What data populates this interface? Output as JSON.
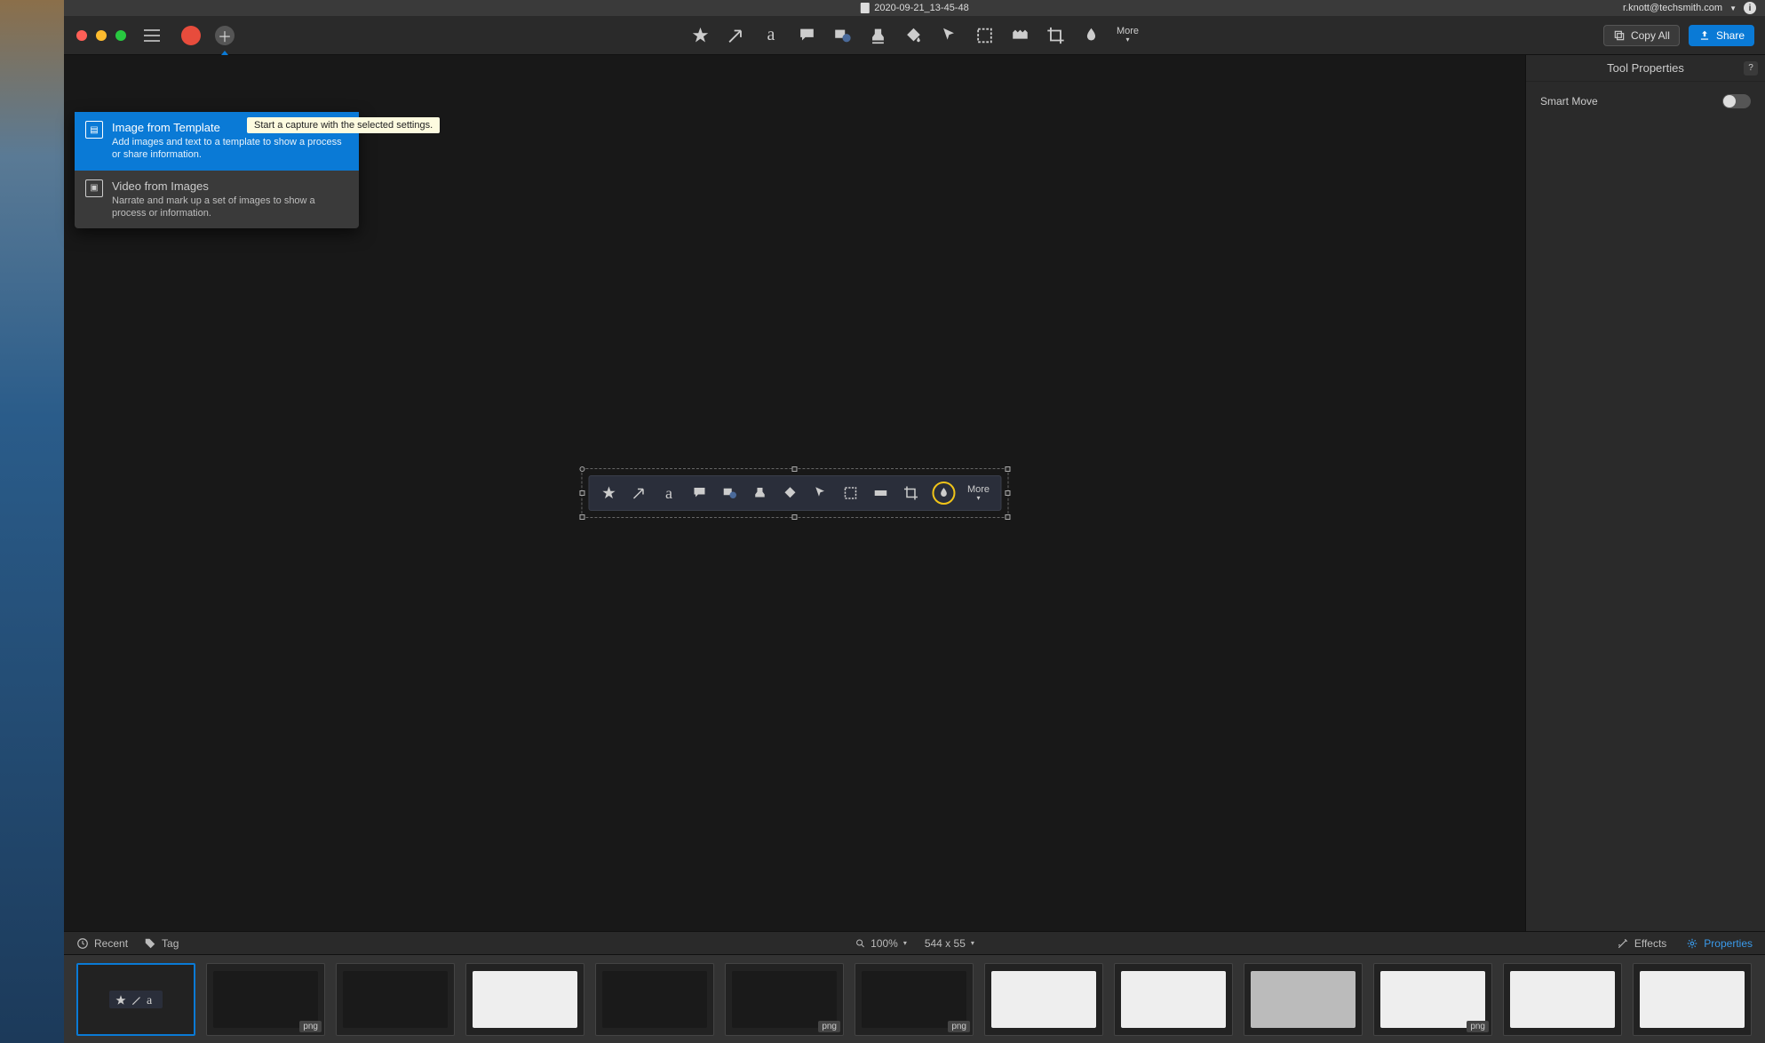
{
  "titlebar": {
    "filename": "2020-09-21_13-45-48",
    "user_email": "r.knott@techsmith.com"
  },
  "toolbar": {
    "more_label": "More",
    "copy_all_label": "Copy All",
    "share_label": "Share",
    "tools": [
      "favorites",
      "arrow",
      "text",
      "callout",
      "shape",
      "stamp",
      "fill",
      "move",
      "selection",
      "blur",
      "crop",
      "simplify"
    ]
  },
  "popover": {
    "items": [
      {
        "title": "Image from Template",
        "desc": "Add images and text to a template to show a process or share information.",
        "selected": true
      },
      {
        "title": "Video from Images",
        "desc": "Narrate and mark up a set of images to show a process or information.",
        "selected": false
      }
    ],
    "tooltip": "Start a capture with the selected settings."
  },
  "properties": {
    "title": "Tool Properties",
    "rows": [
      {
        "label": "Smart Move",
        "value": false
      }
    ]
  },
  "canvas_object": {
    "more_label": "More"
  },
  "tray_bar": {
    "recent": "Recent",
    "tag": "Tag",
    "zoom": "100%",
    "dimensions": "544 x 55",
    "effects": "Effects",
    "properties": "Properties"
  },
  "tray": {
    "thumbs": [
      {
        "type": "selected-bar"
      },
      {
        "type": "dark",
        "badge": "png"
      },
      {
        "type": "dark"
      },
      {
        "type": "light"
      },
      {
        "type": "dark"
      },
      {
        "type": "dark",
        "badge": "png"
      },
      {
        "type": "dark",
        "badge": "png"
      },
      {
        "type": "light"
      },
      {
        "type": "light"
      },
      {
        "type": "gray"
      },
      {
        "type": "light",
        "badge": "png"
      },
      {
        "type": "light"
      },
      {
        "type": "light"
      }
    ]
  }
}
